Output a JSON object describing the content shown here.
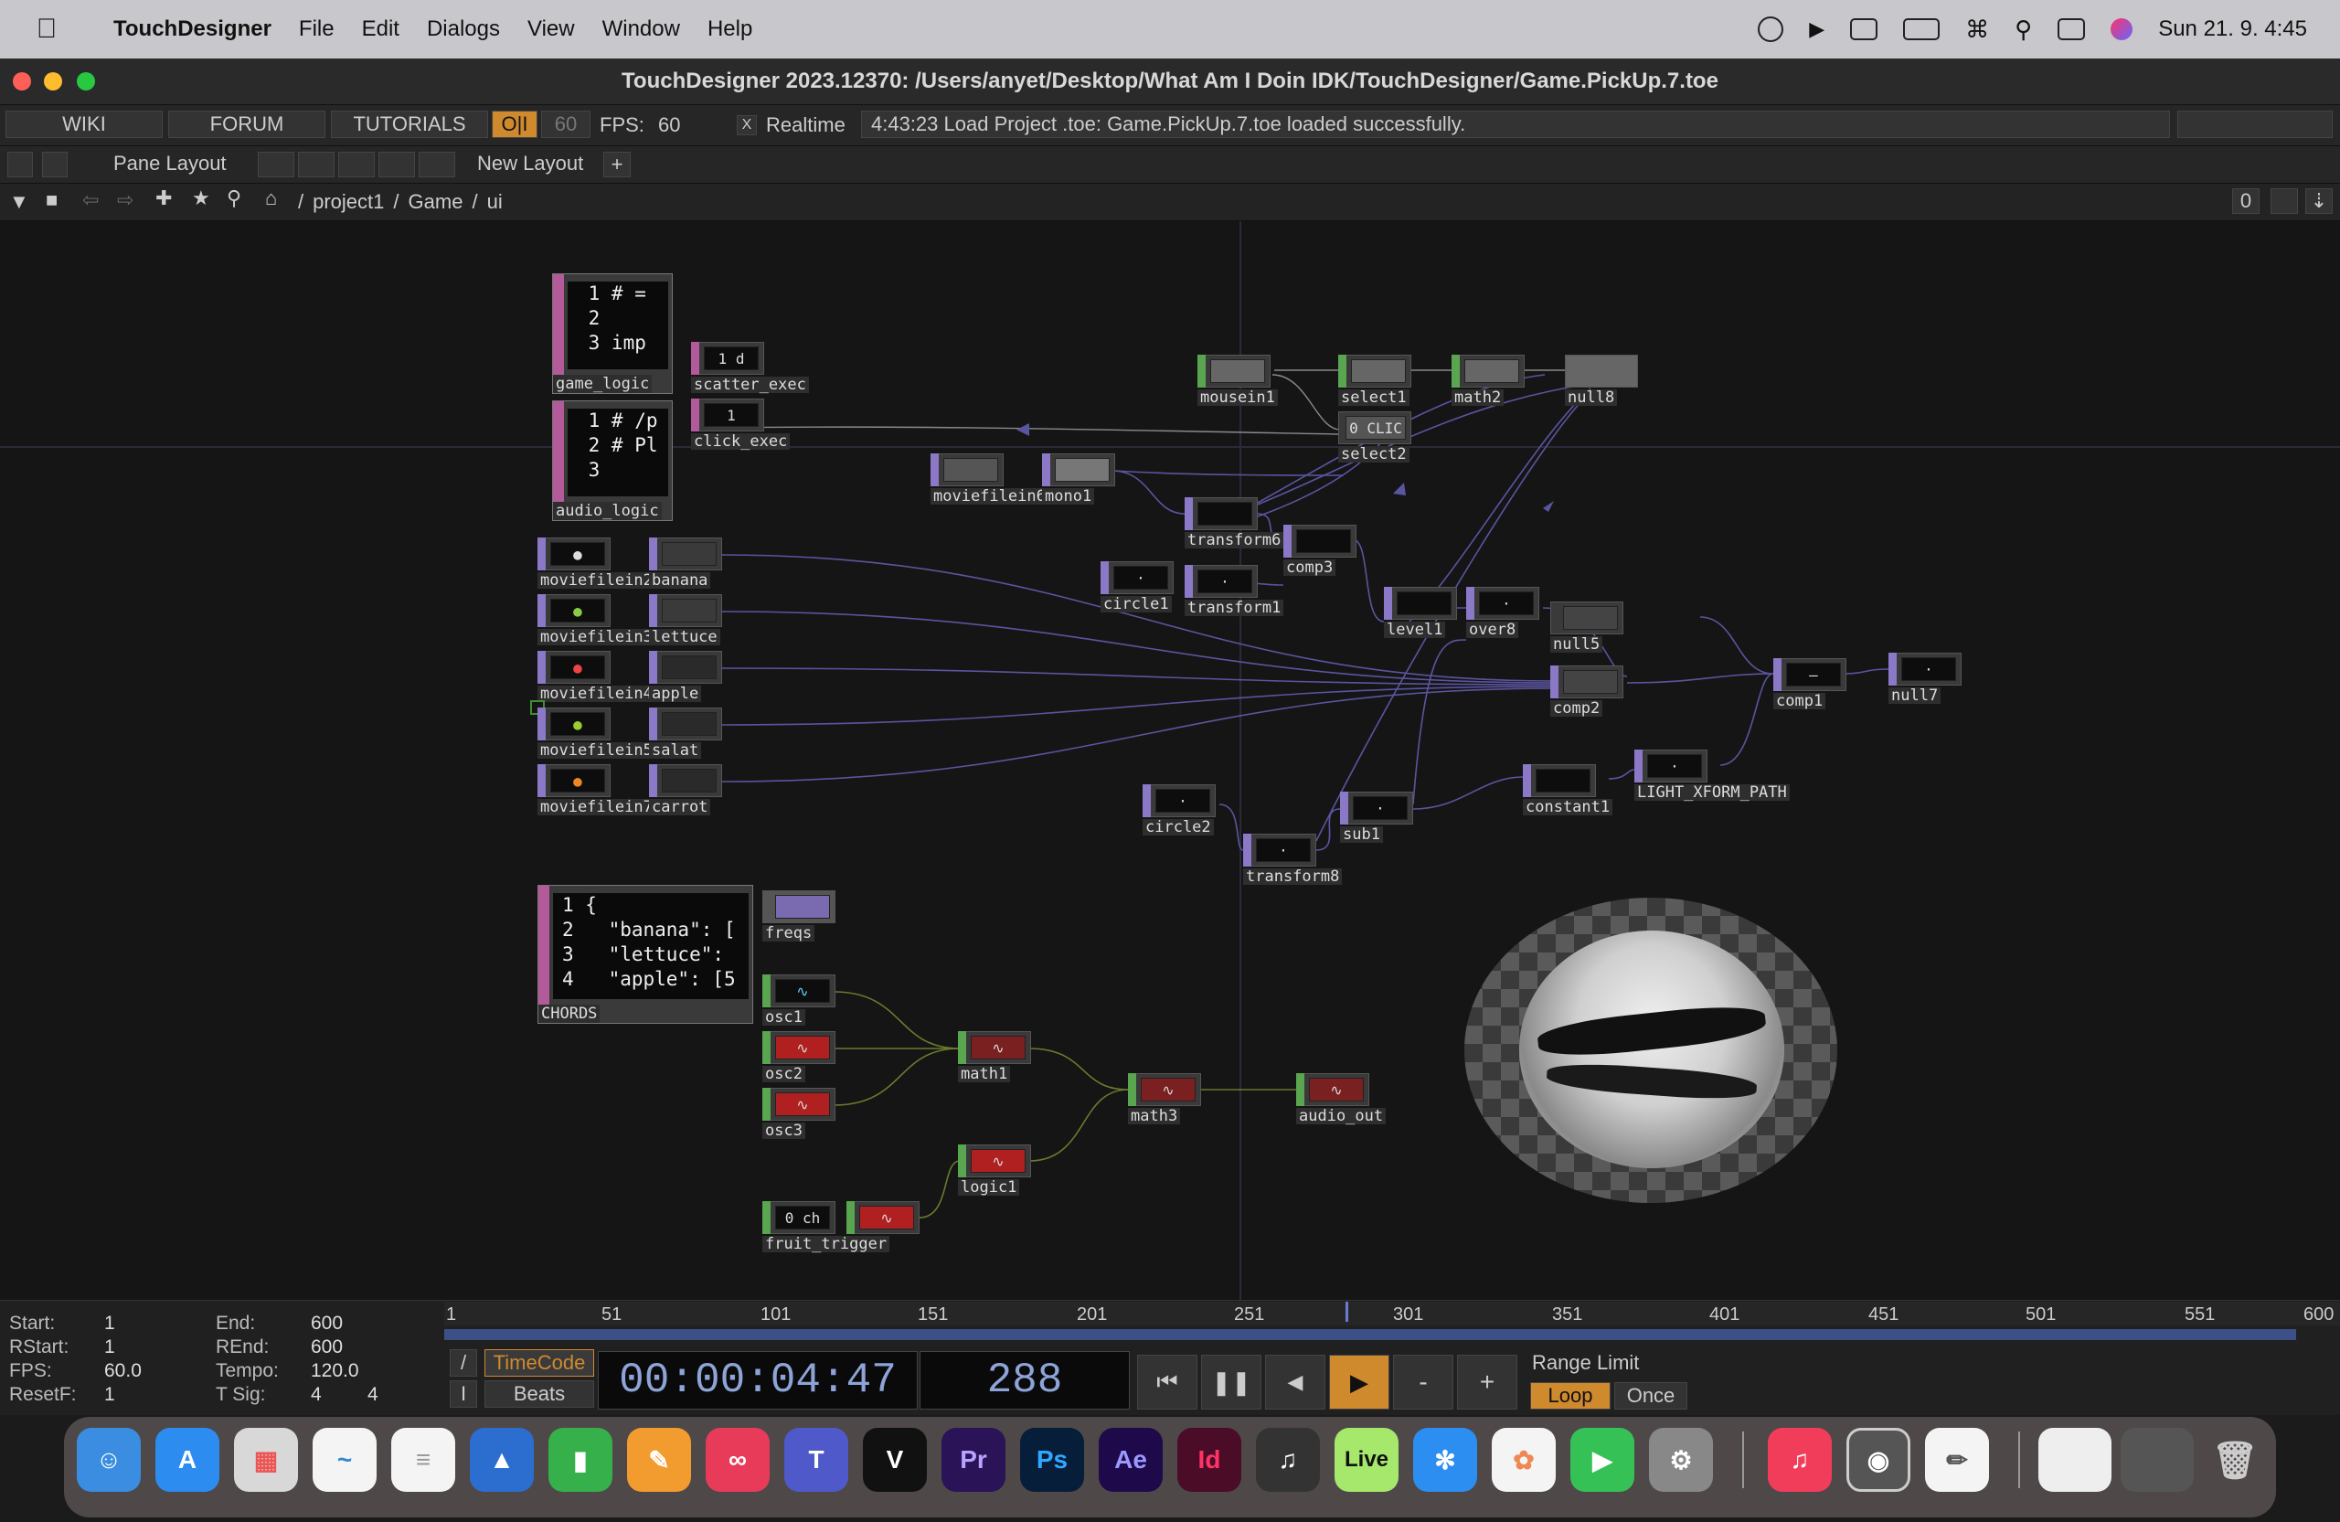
{
  "menubar": {
    "app": "TouchDesigner",
    "items": [
      "File",
      "Edit",
      "Dialogs",
      "View",
      "Window",
      "Help"
    ],
    "clock": "Sun 21. 9.  4:45"
  },
  "window": {
    "title": "TouchDesigner 2023.12370: /Users/anyet/Desktop/What Am I Doin IDK/TouchDesigner/Game.PickUp.7.toe"
  },
  "toolbar": {
    "wiki": "WIKI",
    "forum": "FORUM",
    "tutorials": "TUTORIALS",
    "oi": "O|I",
    "fps_target": "60",
    "fps_label": "FPS:",
    "fps_value": "60",
    "realtime_check": "X",
    "realtime": "Realtime",
    "status": "4:43:23 Load Project .toe: Game.PickUp.7.toe loaded successfully."
  },
  "panebar": {
    "pane_layout": "Pane Layout",
    "new_layout": "New Layout",
    "plus": "+"
  },
  "pathbar": {
    "crumbs": [
      "/",
      "project1",
      "/",
      "Game",
      "/",
      "ui"
    ],
    "counter": "0"
  },
  "operators": {
    "game_logic": {
      "name": "game_logic",
      "code": " 1 # =\n 2\n 3 imp"
    },
    "audio_logic": {
      "name": "audio_logic",
      "code": " 1 # /p\n 2 # Pl\n 3"
    },
    "scatter_exec": {
      "name": "scatter_exec",
      "thumb": "1 d"
    },
    "click_exec": {
      "name": "click_exec",
      "thumb": "1"
    },
    "moviefilein2": "moviefilein2",
    "banana": "banana",
    "moviefilein3": "moviefilein3",
    "lettuce": "lettuce",
    "moviefilein4": "moviefilein4",
    "apple": "apple",
    "moviefilein5": "moviefilein5",
    "salat": "salat",
    "moviefilein7": "moviefilein7",
    "carrot": "carrot",
    "moviefilein6": "moviefilein6",
    "mono1": "mono1",
    "mousein1": "mousein1",
    "select1": "select1",
    "math2": "math2",
    "null8": "null8",
    "select2": {
      "name": "select2",
      "thumb": "0 CLIC"
    },
    "transform6": "transform6",
    "comp3": "comp3",
    "circle1": "circle1",
    "transform1": "transform1",
    "level1": "level1",
    "over8": "over8",
    "null5": "null5",
    "comp2": "comp2",
    "comp1": "comp1",
    "null7": "null7",
    "circle2": "circle2",
    "transform8": "transform8",
    "sub1": "sub1",
    "constant1": "constant1",
    "light_xform": "LIGHT_XFORM_PATH",
    "chords": {
      "name": "CHORDS",
      "code": "1 {\n2   \"banana\": [\n3   \"lettuce\":\n4   \"apple\": [5"
    },
    "freqs": "freqs",
    "osc1": "osc1",
    "osc2": "osc2",
    "osc3": "osc3",
    "math1": "math1",
    "math3": "math3",
    "audio_out": "audio_out",
    "logic1": "logic1",
    "fruit_trigger": {
      "name": "fruit_trigger",
      "thumb": "0 ch"
    }
  },
  "timeline": {
    "ticks": [
      "1",
      "51",
      "101",
      "151",
      "201",
      "251",
      "301",
      "351",
      "401",
      "451",
      "501",
      "551",
      "600"
    ],
    "info": {
      "start_label": "Start:",
      "start": "1",
      "rstart_label": "RStart:",
      "rstart": "1",
      "fps_label": "FPS:",
      "fps": "60.0",
      "resetf_label": "ResetF:",
      "resetf": "1",
      "end_label": "End:",
      "end": "600",
      "rend_label": "REnd:",
      "rend": "600",
      "tempo_label": "Tempo:",
      "tempo": "120.0",
      "tsig_label": "T Sig:",
      "tsig_a": "4",
      "tsig_b": "4"
    },
    "timecode_label": "TimeCode",
    "beats_label": "Beats",
    "timecode": "00:00:04:47",
    "frame": "288",
    "minus": "-",
    "plus": "+",
    "range_limit": "Range Limit",
    "loop": "Loop",
    "once": "Once",
    "playhead_frame": 288
  },
  "dock": [
    "Finder",
    "App Store",
    "Launchpad",
    "Freeform",
    "Reminders",
    "Keynote",
    "Numbers",
    "Pages",
    "Creative Cloud",
    "Teams",
    "Vectorworks",
    "Pr",
    "Ps",
    "Ae",
    "Id",
    "GarageBand",
    "Live",
    "Safari",
    "Photos",
    "FaceTime",
    "System Settings",
    "Music",
    "TouchDesigner",
    "TextEdit",
    "Window",
    "Downloads",
    "Trash"
  ],
  "colors": {
    "chop": "#5aa550",
    "top": "#8b79c8",
    "dat": "#b25a9a",
    "accent": "#d08a2e"
  }
}
